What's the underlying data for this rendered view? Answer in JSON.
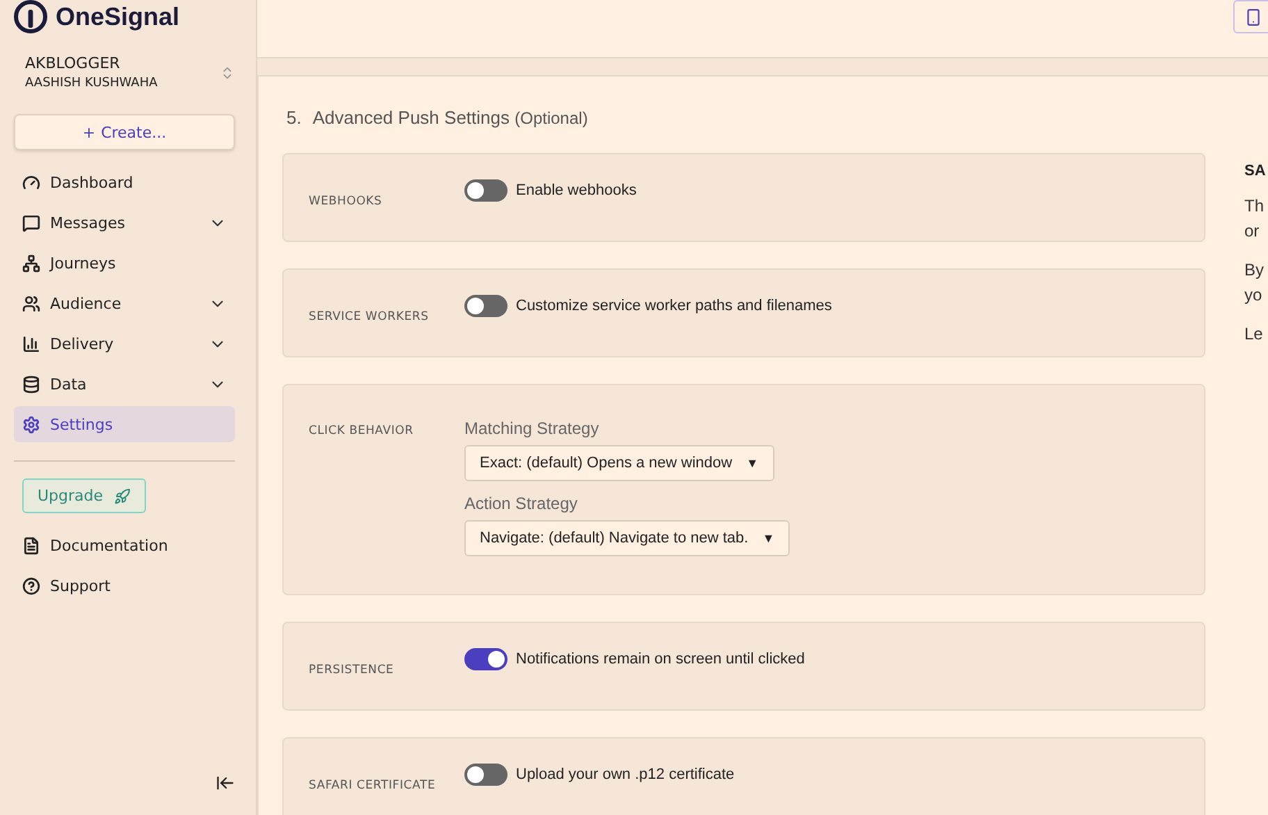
{
  "brand": {
    "name": "OneSignal"
  },
  "account": {
    "org": "AKBLOGGER",
    "user": "AASHISH KUSHWAHA"
  },
  "create_button": {
    "icon": "+",
    "label": "Create..."
  },
  "nav": [
    {
      "label": "Dashboard",
      "expandable": false,
      "selected": false
    },
    {
      "label": "Messages",
      "expandable": true,
      "selected": false
    },
    {
      "label": "Journeys",
      "expandable": false,
      "selected": false
    },
    {
      "label": "Audience",
      "expandable": true,
      "selected": false
    },
    {
      "label": "Delivery",
      "expandable": true,
      "selected": false
    },
    {
      "label": "Data",
      "expandable": true,
      "selected": false
    },
    {
      "label": "Settings",
      "expandable": false,
      "selected": true
    }
  ],
  "upgrade_button": {
    "label": "Upgrade"
  },
  "footer_links": [
    {
      "label": "Documentation"
    },
    {
      "label": "Support"
    }
  ],
  "section": {
    "number": "5.",
    "title": "Advanced Push Settings",
    "suffix": "(Optional)"
  },
  "settings": [
    {
      "kind": "toggle",
      "label": "WEBHOOKS",
      "on": false,
      "text": "Enable webhooks"
    },
    {
      "kind": "toggle",
      "label": "SERVICE WORKERS",
      "on": false,
      "text": "Customize service worker paths and filenames"
    },
    {
      "kind": "selects",
      "label": "CLICK BEHAVIOR",
      "selects": [
        {
          "label": "Matching Strategy",
          "value": "Exact: (default) Opens a new window",
          "arrow": "▼"
        },
        {
          "label": "Action Strategy",
          "value": "Navigate: (default) Navigate to new tab.",
          "arrow": "▼"
        }
      ]
    },
    {
      "kind": "toggle",
      "label": "PERSISTENCE",
      "on": true,
      "text": "Notifications remain on screen until clicked"
    },
    {
      "kind": "toggle",
      "label": "SAFARI CERTIFICATE",
      "on": false,
      "text": "Upload your own .p12 certificate"
    }
  ],
  "side_panel": {
    "title": "SA",
    "lines": [
      "Th",
      "or",
      "By",
      "yo",
      "Le"
    ]
  }
}
